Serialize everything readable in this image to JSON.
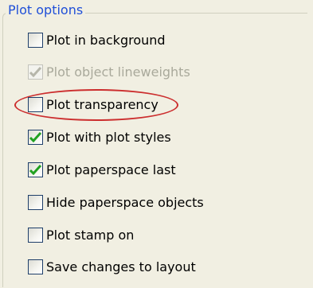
{
  "group": {
    "title": "Plot options"
  },
  "options": [
    {
      "label": "Plot in background",
      "checked": false,
      "enabled": true
    },
    {
      "label": "Plot object lineweights",
      "checked": true,
      "enabled": false
    },
    {
      "label": "Plot transparency",
      "checked": false,
      "enabled": true,
      "highlighted": true
    },
    {
      "label": "Plot with plot styles",
      "checked": true,
      "enabled": true
    },
    {
      "label": "Plot paperspace last",
      "checked": true,
      "enabled": true
    },
    {
      "label": "Hide paperspace objects",
      "checked": false,
      "enabled": true
    },
    {
      "label": "Plot stamp on",
      "checked": false,
      "enabled": true
    },
    {
      "label": "Save changes to layout",
      "checked": false,
      "enabled": true
    }
  ],
  "colors": {
    "check_mark": "#21a121",
    "check_mark_disabled": "#b6b6aa",
    "highlight": "#cc2e2e",
    "legend_text": "#1f4fd8"
  }
}
